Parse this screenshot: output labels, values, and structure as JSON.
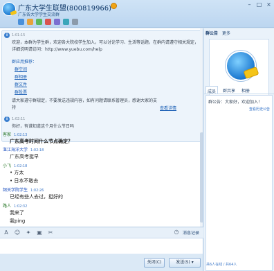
{
  "window": {
    "title": "广东大学生联盟(800819966)",
    "subtitle": "广东各大学学生交流群",
    "controls": [
      "–",
      "□",
      "×"
    ]
  },
  "notice": {
    "time": "1:01:15",
    "text": "欢迎，本群为学生群，欢迎各大院校学生加入，可以讨论学习、生活等话题，在群内请遵守相关规定，详细说明请访问：http://www.yuebu.com/help",
    "links_header": "群应用推荐：",
    "links": [
      "群空间",
      "群相册",
      "群文件",
      "群投票"
    ],
    "footer_text": "请大家遵守群规定，不要发送违规内容，如有问题请联系管理员，感谢大家的支持",
    "footer_link": "查看详情"
  },
  "messages": [
    {
      "time": "1:02:11",
      "name": "",
      "text": "你好，有谁知道这个月什么节日吗",
      "name_color": "blue",
      "bold": false
    },
    {
      "name": "客家",
      "time": "1:02:13",
      "text": "广东高考时间什么节点确定？",
      "bold": true
    },
    {
      "name": "湛江海洋大学",
      "time": "1:02:18",
      "text": "广东高考挺早",
      "bold": false
    },
    {
      "name": "小飞",
      "time": "1:02:18",
      "text": "• 方太",
      "bold": false
    },
    {
      "name": "",
      "time": "",
      "text": "• 日本不敢去",
      "bold": false
    },
    {
      "name": "韶关学院学生",
      "time": "1:02:26",
      "text": "已经有些人去过，挺好的",
      "bold": false
    },
    {
      "name": "路人",
      "time": "1:02:32",
      "text": "我来了",
      "bold": false
    },
    {
      "name": "",
      "time": "",
      "text": "我ping",
      "bold": false
    },
    {
      "name": "",
      "time": "",
      "text": "我ping",
      "bold": false
    }
  ],
  "input_toolbar": {
    "icons": [
      "font-icon",
      "emoji-icon",
      "shake-icon",
      "image-icon",
      "screenshot-icon"
    ],
    "right_label": "消息记录"
  },
  "buttons": {
    "close_label": "关闭(C)",
    "send_label": "发送(S)"
  },
  "sidebar": {
    "tabs": [
      "群公告",
      "更多"
    ],
    "tabs2": [
      "成员",
      "群共享",
      "相册"
    ],
    "panel_text": "群公告：大家好，欢迎加入！",
    "panel_link": "查看历史公告",
    "footer": "共6人在线 / 共64人"
  }
}
